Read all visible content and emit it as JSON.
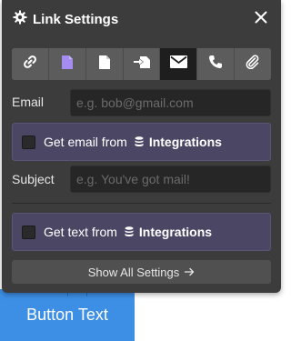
{
  "header": {
    "title": "Link Settings",
    "settings_icon": "gear-icon",
    "close_icon": "close-icon"
  },
  "link_types": [
    {
      "name": "url",
      "icon": "link-icon",
      "active": false
    },
    {
      "name": "page",
      "icon": "page-icon",
      "active": false
    },
    {
      "name": "document",
      "icon": "document-icon",
      "active": false
    },
    {
      "name": "section",
      "icon": "section-arrow-icon",
      "active": false
    },
    {
      "name": "email",
      "icon": "envelope-icon",
      "active": true
    },
    {
      "name": "phone",
      "icon": "phone-icon",
      "active": false
    },
    {
      "name": "file",
      "icon": "paperclip-icon",
      "active": false
    }
  ],
  "email": {
    "label": "Email",
    "placeholder": "e.g. bob@gmail.com",
    "value": ""
  },
  "email_integration": {
    "prefix": "Get email from",
    "name": "Integrations",
    "checked": false
  },
  "subject": {
    "label": "Subject",
    "placeholder": "e.g. You've got mail!",
    "value": ""
  },
  "text_integration": {
    "prefix": "Get text from",
    "name": "Integrations",
    "checked": false
  },
  "footer": {
    "show_all_label": "Show All Settings",
    "arrow_icon": "arrow-right-icon"
  },
  "background": {
    "button_text": "Button Text"
  },
  "colors": {
    "panel": "#3c3c3c",
    "integration_box": "#4c4665",
    "active_tab": "#1e1e1e",
    "accent_purple": "#a58cf0",
    "page_button": "#3d8fe6"
  }
}
